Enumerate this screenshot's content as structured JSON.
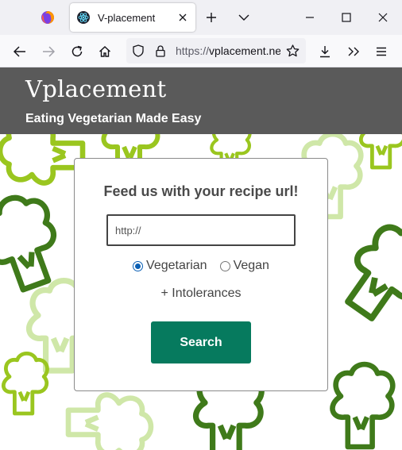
{
  "browser": {
    "tab_title": "V-placement",
    "url_prefix": "https://",
    "url_host": "vplacement.ne",
    "icons": [
      "firefox-icon",
      "react-favicon-icon",
      "close-icon",
      "new-tab-icon",
      "list-tabs-icon",
      "minimize-icon",
      "maximize-icon",
      "window-close-icon",
      "back-icon",
      "forward-icon",
      "reload-icon",
      "home-icon",
      "shield-icon",
      "lock-icon",
      "bookmark-star-icon",
      "downloads-icon",
      "overflow-icon",
      "menu-icon"
    ]
  },
  "header": {
    "title": "Vplacement",
    "tagline": "Eating Vegetarian Made Easy",
    "background_color": "#5a5a5a"
  },
  "form": {
    "heading": "Feed us with your recipe url!",
    "url_placeholder": "http://",
    "url_value": "",
    "diet_options": [
      {
        "label": "Vegetarian",
        "selected": true
      },
      {
        "label": "Vegan",
        "selected": false
      }
    ],
    "intolerances_label": "+ Intolerances",
    "search_label": "Search",
    "search_color": "#067a5e"
  },
  "background": {
    "pattern": "broccoli outlines",
    "colors": [
      "#9ac61f",
      "#3f7a1a",
      "#cfe7a8"
    ]
  }
}
